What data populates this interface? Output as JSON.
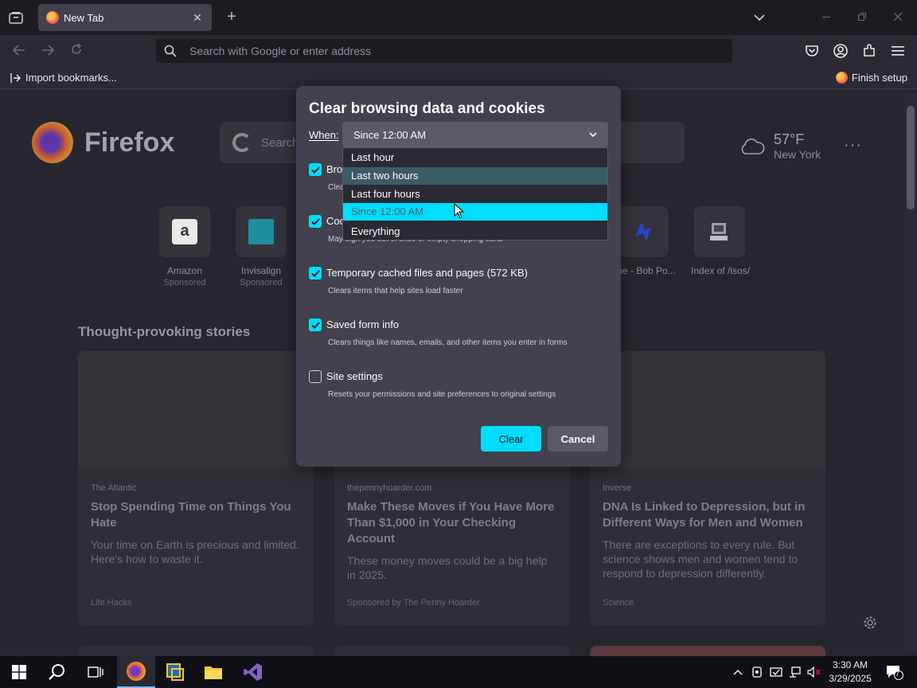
{
  "tab": {
    "title": "New Tab",
    "close": "✕"
  },
  "newtab": "+",
  "urlbar": {
    "placeholder": "Search with Google or enter address"
  },
  "bookmarks": {
    "import": "Import bookmarks...",
    "finish_setup": "Finish setup"
  },
  "newtab_page": {
    "brand": "Firefox",
    "search_placeholder": "Search",
    "weather": {
      "temp": "57°F",
      "city": "New York"
    },
    "menu_dots": "···",
    "shortcuts": [
      {
        "label": "Amazon",
        "sponsored": "Sponsored"
      },
      {
        "label": "Invisalign",
        "sponsored": "Sponsored"
      },
      {
        "label": "me - Bob Po..."
      },
      {
        "label": "Index of /isos/"
      }
    ],
    "stories_title": "Thought-provoking stories",
    "stories": [
      {
        "source": "The Atlantic",
        "headline": "Stop Spending Time on Things You Hate",
        "desc": "Your time on Earth is precious and limited. Here’s how to waste it.",
        "footer": "Life Hacks"
      },
      {
        "source": "thepennyhoarder.com",
        "headline": "Make These Moves if You Have More Than $1,000 in Your Checking Account",
        "desc": "These money moves could be a big help in 2025.",
        "footer": "Sponsored by The Penny Hoarder"
      },
      {
        "source": "Inverse",
        "headline": "DNA Is Linked to Depression, but in Different Ways for Men and Women",
        "desc": "There are exceptions to every rule. But science shows men and women tend to respond to depression differently.",
        "footer": "Science"
      }
    ]
  },
  "dialog": {
    "title": "Clear browsing data and cookies",
    "when_label": "When:",
    "when_value": "Since 12:00 AM",
    "options": [
      {
        "label": "Bro",
        "desc": "Clea",
        "checked": true
      },
      {
        "label": "Coo",
        "desc": "May sign you out of sites or empty shopping carts",
        "checked": true
      },
      {
        "label": "Temporary cached files and pages (572 KB)",
        "desc": "Clears items that help sites load faster",
        "checked": true
      },
      {
        "label": "Saved form info",
        "desc": "Clears things like names, emails, and other items you enter in forms",
        "checked": true
      },
      {
        "label": "Site settings",
        "desc": "Resets your permissions and site preferences to original settings",
        "checked": false
      }
    ],
    "clear_button": "Clear",
    "cancel_button": "Cancel",
    "dropdown": [
      "Last hour",
      "Last two hours",
      "Last four hours",
      "Since 12:00 AM",
      "Everything"
    ]
  },
  "taskbar": {
    "time": "3:30 AM",
    "date": "3/29/2025",
    "notifications": "7"
  },
  "colors": {
    "accent": "#00ddff",
    "dialog_bg": "#42414d",
    "chrome_bg": "#1c1b22"
  }
}
